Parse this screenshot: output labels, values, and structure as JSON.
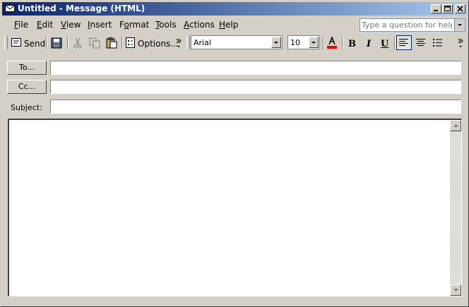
{
  "window": {
    "title": "Untitled - Message (HTML)",
    "title_bar_colors": {
      "start": "#0a246a",
      "end": "#a6caf0"
    }
  },
  "menubar": {
    "items": [
      {
        "label": "File",
        "accel": "F"
      },
      {
        "label": "Edit",
        "accel": "E"
      },
      {
        "label": "View",
        "accel": "V"
      },
      {
        "label": "Insert",
        "accel": "I"
      },
      {
        "label": "Format",
        "accel": "o"
      },
      {
        "label": "Tools",
        "accel": "T"
      },
      {
        "label": "Actions",
        "accel": "A"
      },
      {
        "label": "Help",
        "accel": "H"
      }
    ],
    "help_placeholder": "Type a question for help"
  },
  "toolbar": {
    "send_label": "Send",
    "options_label": "Options...",
    "font_name": "Arial",
    "font_size": "10",
    "bold_label": "B",
    "italic_label": "I",
    "underline_label": "U",
    "font_color": "#ff0000"
  },
  "fields": {
    "to_button": "To...",
    "cc_button": "Cc...",
    "subject_label": "Subject:",
    "to_value": "",
    "cc_value": "",
    "subject_value": ""
  },
  "body": {
    "text": ""
  }
}
